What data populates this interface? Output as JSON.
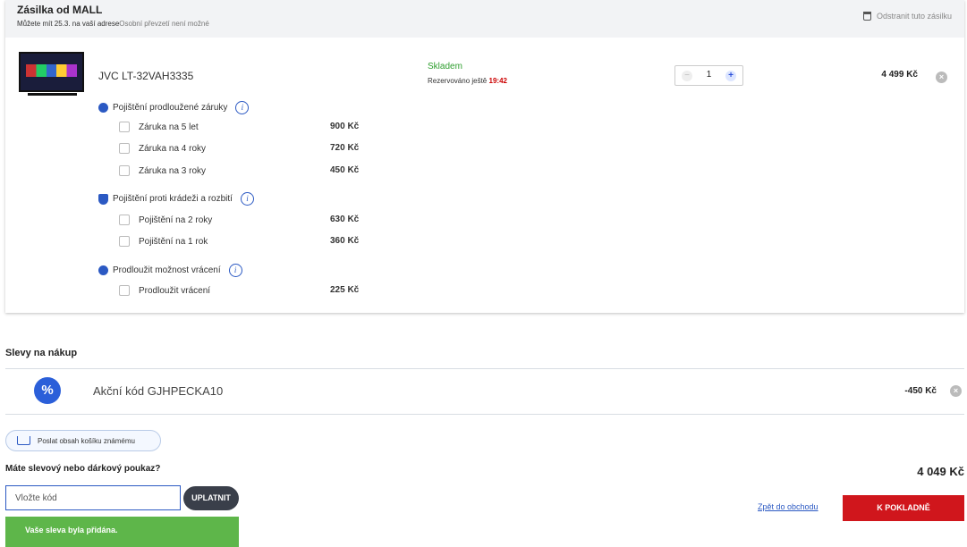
{
  "shipment": {
    "title": "Zásilka od MALL",
    "delivery_note": "Můžete mít 25.3. na vaší adrese",
    "pickup_note": "Osobní převzetí není možné",
    "remove_label": "Odstranit tuto zásilku"
  },
  "product": {
    "name": "JVC LT-32VAH3335",
    "stock_status": "Skladem",
    "reserved_prefix": "Rezervováno ještě",
    "reserved_time": "19:42",
    "quantity": "1",
    "price": "4 499 Kč"
  },
  "insurance_sections": [
    {
      "title": "Pojištění prodloužené záruky",
      "icon": "medal-icon",
      "options": [
        {
          "label": "Záruka na 5 let",
          "price": "900 Kč"
        },
        {
          "label": "Záruka na 4 roky",
          "price": "720 Kč"
        },
        {
          "label": "Záruka na 3 roky",
          "price": "450 Kč"
        }
      ]
    },
    {
      "title": "Pojištění proti krádeži a rozbití",
      "icon": "shield-icon",
      "options": [
        {
          "label": "Pojištění na 2 roky",
          "price": "630 Kč"
        },
        {
          "label": "Pojištění na 1 rok",
          "price": "360 Kč"
        }
      ]
    },
    {
      "title": "Prodloužit možnost vrácení",
      "icon": "return-icon",
      "options": [
        {
          "label": "Prodloužit vrácení",
          "price": "225 Kč"
        }
      ]
    }
  ],
  "discounts": {
    "heading": "Slevy na nákup",
    "code_label": "Akční kód GJHPECKA10",
    "amount": "-450 Kč",
    "badge": "%"
  },
  "share_label": "Poslat obsah košíku známému",
  "voucher": {
    "question": "Máte slevový nebo dárkový poukaz?",
    "placeholder": "Vložte kód",
    "apply_label": "UPLATNIT"
  },
  "total": "4 049 Kč",
  "back_label": "Zpět do obchodu",
  "checkout_label": "K POKLADNĚ",
  "alert_message": "Vaše sleva byla přidána.",
  "colors": {
    "accent": "#2b59c3",
    "checkout": "#d0161c",
    "success": "#5eb64a",
    "stock": "#2e9e2e"
  }
}
